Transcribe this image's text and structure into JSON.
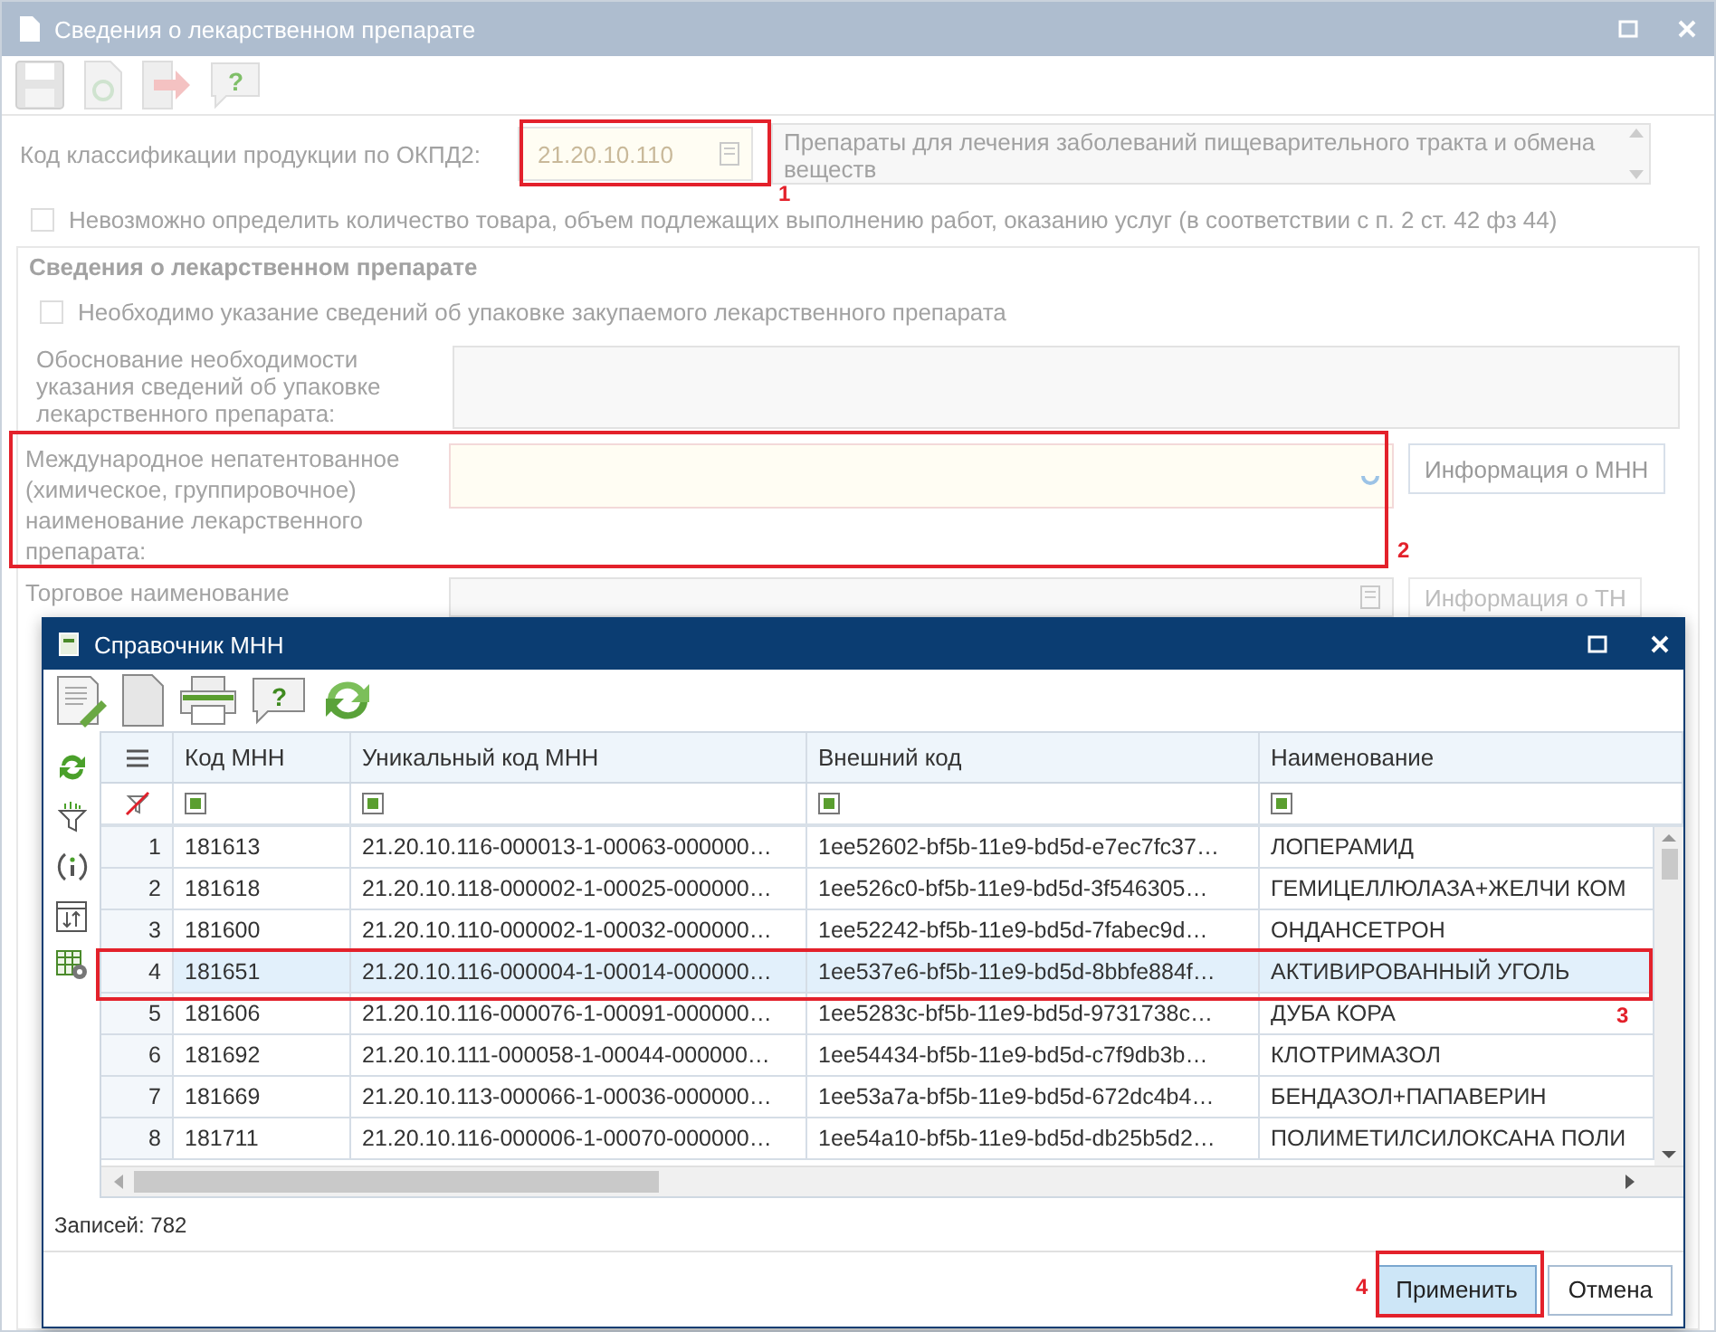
{
  "window": {
    "title": "Сведения о лекарственном препарате",
    "toolbar": {
      "help_glyph": "?"
    }
  },
  "form": {
    "okpd": {
      "label": "Код классификации продукции по ОКПД2:",
      "value": "21.20.10.110",
      "description": "Препараты для лечения заболеваний пищеварительного тракта и обмена веществ"
    },
    "cannot_determine": {
      "label": "Невозможно определить количество товара, объем подлежащих выполнению работ, оказанию услуг (в соответствии с п. 2 ст. 42 фз 44)",
      "checked": false
    },
    "section": {
      "title": "Сведения о лекарственном препарате",
      "packaging_required": {
        "label": "Необходимо указание сведений об упаковке закупаемого лекарственного препарата",
        "checked": false
      },
      "justification": {
        "label": "Обоснование необходимости указания сведений об упаковке лекарственного препарата:"
      },
      "mnn": {
        "label": "Международное непатентованное (химическое, группировочное) наименование лекарственного препарата:",
        "button": {
          "label": "Информация о МНН",
          "disabled": false
        }
      },
      "trade_name": {
        "label": "Торговое наименование",
        "button": {
          "label": "Информация о ТН",
          "disabled": true
        }
      }
    }
  },
  "dialog": {
    "title": "Справочник МНН",
    "toolbar": {
      "help_glyph": "?"
    },
    "columns": [
      "Код МНН",
      "Уникальный код МНН",
      "Внешний код",
      "Наименование"
    ],
    "rows": [
      {
        "number": "1",
        "code": "181613",
        "unique_code": "21.20.10.116-000013-1-00063-000000…",
        "external_code": "1ee52602-bf5b-11e9-bd5d-e7ec7fc37…",
        "name": "ЛОПЕРАМИД",
        "selected": false
      },
      {
        "number": "2",
        "code": "181618",
        "unique_code": "21.20.10.118-000002-1-00025-000000…",
        "external_code": "1ee526c0-bf5b-11e9-bd5d-3f546305…",
        "name": "ГЕМИЦЕЛЛЮЛАЗА+ЖЕЛЧИ КОМ",
        "selected": false
      },
      {
        "number": "3",
        "code": "181600",
        "unique_code": "21.20.10.110-000002-1-00032-000000…",
        "external_code": "1ee52242-bf5b-11e9-bd5d-7fabec9d…",
        "name": "ОНДАНСЕТРОН",
        "selected": false
      },
      {
        "number": "4",
        "code": "181651",
        "unique_code": "21.20.10.116-000004-1-00014-000000…",
        "external_code": "1ee537e6-bf5b-11e9-bd5d-8bbfe884f…",
        "name": "АКТИВИРОВАННЫЙ УГОЛЬ",
        "selected": true
      },
      {
        "number": "5",
        "code": "181606",
        "unique_code": "21.20.10.116-000076-1-00091-000000…",
        "external_code": "1ee5283c-bf5b-11e9-bd5d-9731738c…",
        "name": "ДУБА КОРА",
        "selected": false
      },
      {
        "number": "6",
        "code": "181692",
        "unique_code": "21.20.10.111-000058-1-00044-000000…",
        "external_code": "1ee54434-bf5b-11e9-bd5d-c7f9db3b…",
        "name": "КЛОТРИМАЗОЛ",
        "selected": false
      },
      {
        "number": "7",
        "code": "181669",
        "unique_code": "21.20.10.113-000066-1-00036-000000…",
        "external_code": "1ee53a7a-bf5b-11e9-bd5d-672dc4b4…",
        "name": "БЕНДАЗОЛ+ПАПАВЕРИН",
        "selected": false
      },
      {
        "number": "8",
        "code": "181711",
        "unique_code": "21.20.10.116-000006-1-00070-000000…",
        "external_code": "1ee54a10-bf5b-11e9-bd5d-db25b5d2…",
        "name": "ПОЛИМЕТИЛСИЛОКСАНА ПОЛИ",
        "selected": false
      }
    ],
    "record_count": "Записей: 782",
    "buttons": [
      {
        "label": "Применить",
        "kind": "primary"
      },
      {
        "label": "Отмена",
        "kind": "secondary"
      }
    ]
  },
  "annotations": [
    {
      "number": "1"
    },
    {
      "number": "2"
    },
    {
      "number": "3"
    },
    {
      "number": "4"
    }
  ]
}
